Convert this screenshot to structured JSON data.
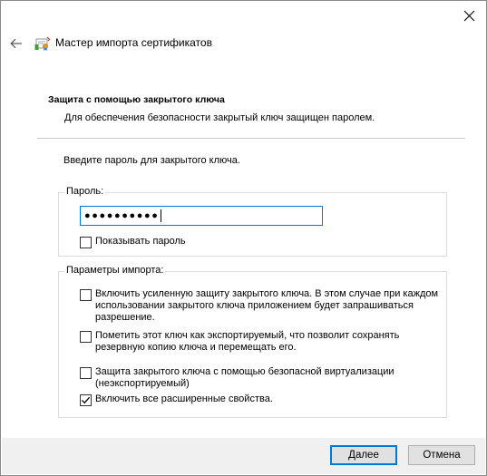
{
  "window": {
    "title": "Мастер импорта сертификатов"
  },
  "header": {
    "heading": "Защита с помощью закрытого ключа",
    "subtitle": "Для обеспечения безопасности закрытый ключ защищен паролем."
  },
  "prompt": "Введите пароль для закрытого ключа.",
  "password_group": {
    "label": "Пароль:",
    "value": "●●●●●●●●●●",
    "show_password": {
      "label": "Показывать пароль",
      "checked": false
    }
  },
  "import_group": {
    "label": "Параметры импорта:",
    "options": [
      {
        "lines": [
          "Включить усиленную защиту закрытого ключа. В этом случае при каждом",
          "использовании закрытого ключа приложением будет запрашиваться",
          "разрешение."
        ],
        "checked": false
      },
      {
        "lines": [
          "Пометить этот ключ как экспортируемый, что позволит сохранять",
          "резервную копию ключа и перемещать его."
        ],
        "checked": false
      },
      {
        "lines": [
          "Защита закрытого ключа с помощью безопасной виртуализации",
          "(неэкспортируемый)"
        ],
        "checked": false
      },
      {
        "lines": [
          "Включить все расширенные свойства."
        ],
        "checked": true
      }
    ]
  },
  "buttons": {
    "next": "Далее",
    "cancel": "Отмена"
  },
  "colors": {
    "accent": "#0078d7",
    "footer": "#f0f0f0"
  },
  "icons": {
    "close": "close-icon",
    "back": "back-arrow-icon",
    "wizard": "certificate-wizard-icon",
    "check": "checkmark-icon"
  }
}
